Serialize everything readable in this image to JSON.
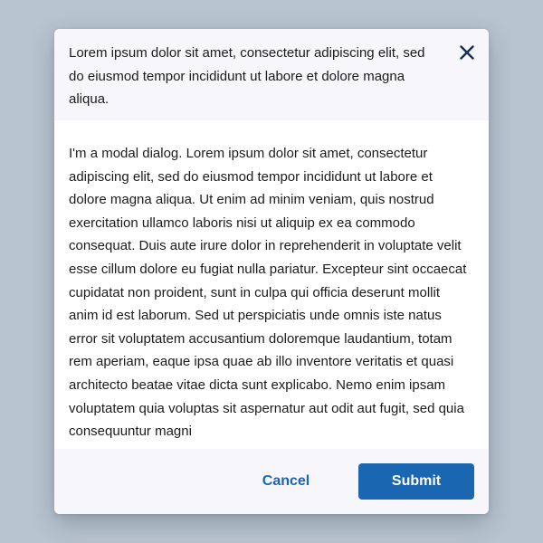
{
  "modal": {
    "title": "Lorem ipsum dolor sit amet, consectetur adipiscing elit, sed do eiusmod tempor incididunt ut labore et dolore magna aliqua.",
    "close_icon": "close-icon",
    "body_text": "I'm a modal dialog. Lorem ipsum dolor sit amet, consectetur adipiscing elit, sed do eiusmod tempor incididunt ut labore et dolore magna aliqua. Ut enim ad minim veniam, quis nostrud exercitation ullamco laboris nisi ut aliquip ex ea commodo consequat. Duis aute irure dolor in reprehenderit in voluptate velit esse cillum dolore eu fugiat nulla pariatur. Excepteur sint occaecat cupidatat non proident, sunt in culpa qui officia deserunt mollit anim id est laborum. Sed ut perspiciatis unde omnis iste natus error sit voluptatem accusantium doloremque laudantium, totam rem aperiam, eaque ipsa quae ab illo inventore veritatis et quasi architecto beatae vitae dicta sunt explicabo. Nemo enim ipsam voluptatem quia voluptas sit aspernatur aut odit aut fugit, sed quia consequuntur magni",
    "cancel_label": "Cancel",
    "submit_label": "Submit"
  },
  "colors": {
    "backdrop": "#b8c4cf",
    "header_footer_bg": "#f6f6fb",
    "primary": "#1a66b0",
    "text": "#1b1b1b"
  }
}
